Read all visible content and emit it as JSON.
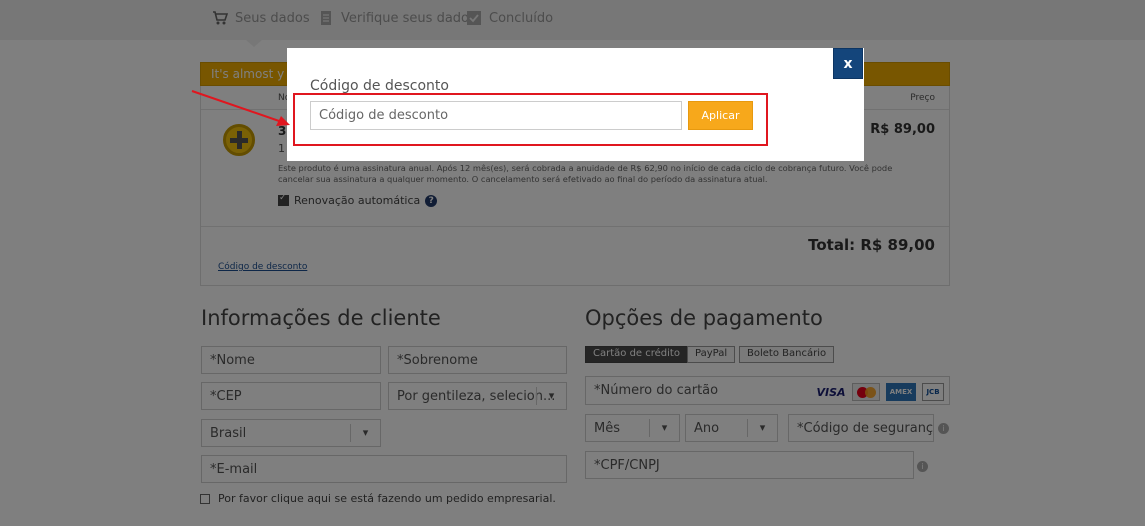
{
  "steps": [
    {
      "label": "Seus dados",
      "icon": "cart-icon"
    },
    {
      "label": "Verifique seus dados",
      "icon": "document-icon"
    },
    {
      "label": "Concluído",
      "icon": "check-icon"
    }
  ],
  "banner": {
    "text": "It's almost y"
  },
  "cart": {
    "col_name": "No",
    "col_price": "Preço",
    "product_name": "3",
    "product_qty": "1",
    "product_price": "R$ 89,00",
    "description": "Este produto é uma assinatura anual. Após 12 mês(es), será cobrada a anuidade de R$ 62,90 no início de cada ciclo de cobrança futuro. Você pode cancelar sua assinatura a qualquer momento. O cancelamento será efetivado ao final do período da assinatura atual.",
    "renewal_label": "Renovação automática",
    "help": "?",
    "total": "Total: R$ 89,00",
    "coupon_link": "Código de desconto"
  },
  "client": {
    "title": "Informações de cliente",
    "first_name": "*Nome",
    "last_name": "*Sobrenome",
    "cep": "*CEP",
    "state": "Por gentileza, selecion...",
    "country": "Brasil",
    "email": "*E-mail",
    "business_label": "Por favor clique aqui se está fazendo um pedido empresarial."
  },
  "payment": {
    "title": "Opções de pagamento",
    "tabs": [
      "Cartão de crédito",
      "PayPal",
      "Boleto Bancário"
    ],
    "card_number": "*Número do cartão",
    "card_brands": [
      "VISA",
      "MasterCard",
      "AMEX",
      "JCB"
    ],
    "month": "Mês",
    "year": "Ano",
    "security_code": "*Código de segurança",
    "cpf": "*CPF/CNPJ",
    "info": "i"
  },
  "modal": {
    "title": "Código de desconto",
    "input_placeholder": "Código de desconto",
    "apply_label": "Aplicar",
    "close_label": "x"
  },
  "colors": {
    "accent": "#f7a81b",
    "close": "#14457b",
    "highlight": "#e0161f"
  }
}
